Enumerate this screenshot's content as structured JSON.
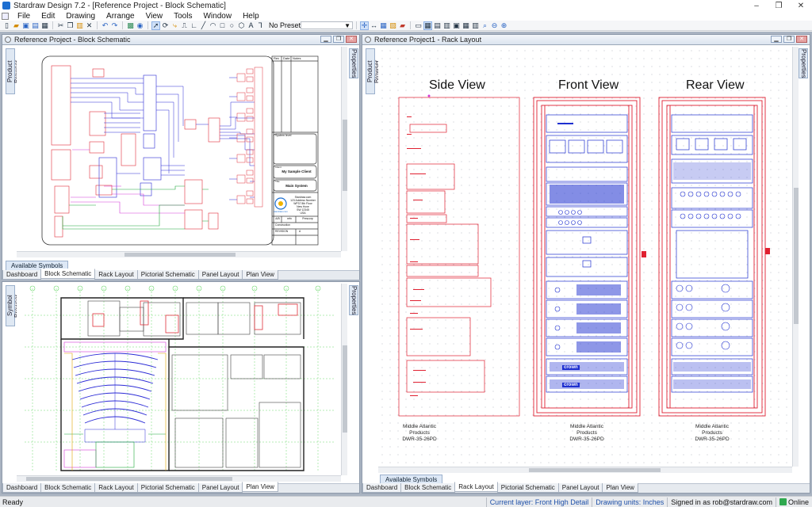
{
  "app": {
    "title": "Stardraw Design 7.2 - [Reference Project - Block Schematic]",
    "window_buttons": [
      "–",
      "❐",
      "✕"
    ]
  },
  "menu": [
    "File",
    "Edit",
    "Drawing",
    "Arrange",
    "View",
    "Tools",
    "Window",
    "Help"
  ],
  "toolbar": {
    "preset_label": "No Preset",
    "preset_arrow": "▼"
  },
  "left_top_window": {
    "title": "Reference Project - Block Schematic",
    "side_left": "Product Browser",
    "side_right": "Properties",
    "available_symbols": "Available Symbols",
    "tabs": [
      "Dashboard",
      "Block Schematic",
      "Rack Layout",
      "Pictorial Schematic",
      "Panel Layout",
      "Plan View"
    ],
    "active_tab": 1,
    "title_block": {
      "rev_head": [
        "Rev",
        "Date",
        "Notes"
      ],
      "system_level": "System level",
      "client_label": "Client",
      "client_value": "My Sample Client",
      "title_label": "Title",
      "title_value": "Main System",
      "company": "Stardraw.com",
      "company_addr": [
        "123 Address Number",
        "WP37 8th Floor",
        "New Hove",
        "SW 12345",
        "USA"
      ],
      "logo_text": "stardraw.com",
      "bottom_cells": [
        "A/B",
        "refn",
        "Prescorp"
      ],
      "bottom_rows": [
        "Construction",
        "REVISION"
      ],
      "revision_no": "A"
    }
  },
  "left_bottom_window": {
    "side_left": "Symbol Browser",
    "side_right": "Properties",
    "tabs": [
      "Dashboard",
      "Block Schematic",
      "Rack Layout",
      "Pictorial Schematic",
      "Panel Layout",
      "Plan View"
    ],
    "active_tab": 5
  },
  "right_window": {
    "title": "Reference Project1 - Rack Layout",
    "side_left": "Product Browser",
    "side_right": "Properties",
    "views": [
      "Side View",
      "Front View",
      "Rear View"
    ],
    "rack_captions": [
      [
        "Middle Atlantic Products",
        "DWR-35-26PD"
      ],
      [
        "Middle Atlantic Products",
        "DWR-35-26PD"
      ],
      [
        "Middle Atlantic Products",
        "DWR-35-26PD"
      ]
    ],
    "available_symbols": "Available Symbols",
    "tabs": [
      "Dashboard",
      "Block Schematic",
      "Rack Layout",
      "Pictorial Schematic",
      "Panel Layout",
      "Plan View"
    ],
    "active_tab": 2,
    "brand_labels": [
      "crown",
      "crown"
    ]
  },
  "status": {
    "ready": "Ready",
    "layer": "Current layer: Front High Detail",
    "units": "Drawing units: Inches",
    "signed": "Signed in as rob@stardraw.com",
    "online": "Online"
  },
  "colors": {
    "schematic_blue": "#2b2bd6",
    "schematic_red": "#e0303a",
    "schematic_green": "#1fa83a",
    "schematic_magenta": "#d23ad8",
    "rack_red": "#e02030",
    "rack_blue": "#1e2fd0"
  }
}
